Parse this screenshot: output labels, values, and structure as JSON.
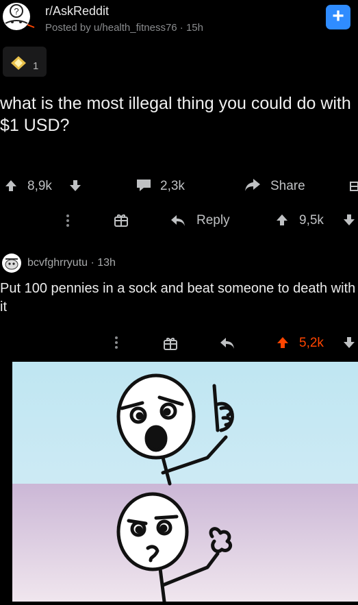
{
  "post": {
    "subreddit": "r/AskReddit",
    "posted_by": "Posted by u/health_fitness76 · 15h",
    "award_count": "1",
    "title": "what is the most illegal thing you could do with $1 USD?",
    "upvotes": "8,9k",
    "comments": "2,3k",
    "share_label": "Share"
  },
  "parent_comment_actions": {
    "reply_label": "Reply",
    "score": "9,5k"
  },
  "comment": {
    "author": "bcvfghrryutu · 13h",
    "text": "Put 100 pennies in a sock and beat someone to death with it",
    "score": "5,2k",
    "accent_upvote_color": "#ff4500"
  },
  "colors": {
    "background": "#000000",
    "join_button": "#2f8cff",
    "meme_top": "#bfe6f2",
    "meme_bottom": "#d6c6dd"
  },
  "icons": [
    "subreddit-avatar-icon",
    "plus-icon",
    "award-icon",
    "upvote-icon",
    "downvote-icon",
    "comment-icon",
    "share-icon",
    "more-icon",
    "gift-icon",
    "reply-icon",
    "user-avatar-icon"
  ]
}
